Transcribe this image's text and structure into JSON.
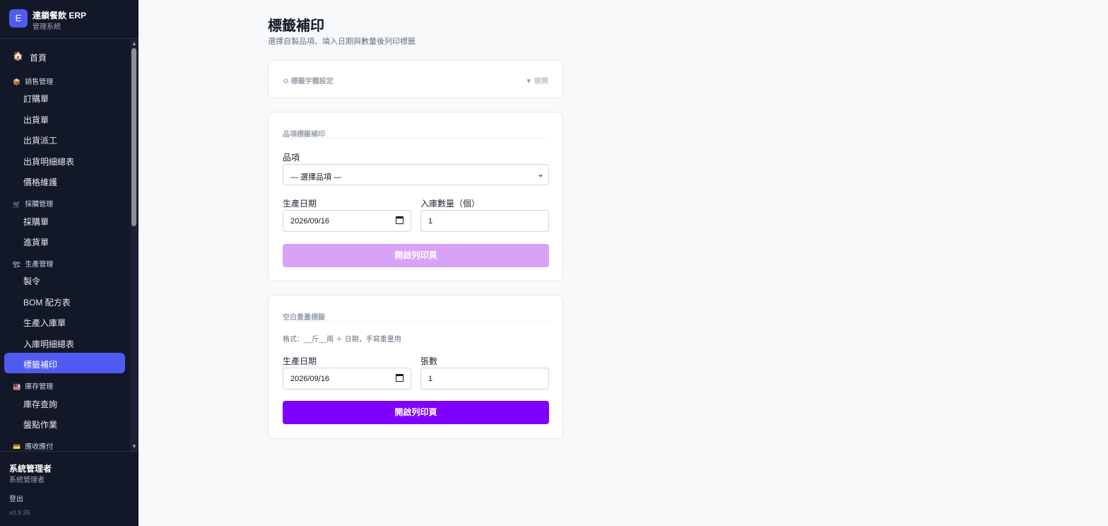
{
  "brand": {
    "logo": "E",
    "name": "連鎖餐飲 ERP",
    "sub": "管理系統"
  },
  "nav": {
    "home": {
      "icon": "🏠",
      "label": "首頁"
    },
    "groups": {
      "sales": {
        "icon": "📦",
        "label": "銷售管理"
      },
      "purchase": {
        "icon": "🛒",
        "label": "採購管理"
      },
      "production": {
        "icon": "🏗",
        "label": "生產管理"
      },
      "inventory": {
        "icon": "🏭",
        "label": "庫存管理"
      },
      "finance": {
        "icon": "💳",
        "label": "應收應付"
      }
    },
    "items": {
      "orders": "訂購單",
      "shipping": "出貨單",
      "dispatch": "出貨派工",
      "ship_detail": "出貨明細總表",
      "price": "價格維護",
      "purchase_order": "採購單",
      "receiving": "進貨單",
      "work_order": "製令",
      "bom": "BOM 配方表",
      "prod_in": "生產入庫單",
      "in_detail": "入庫明細總表",
      "label_reprint": "標籤補印",
      "stock_query": "庫存查詢",
      "stocktake": "盤點作業"
    }
  },
  "user": {
    "name": "系統管理者",
    "role": "系統管理者",
    "logout": "登出",
    "version": "v0.9.35"
  },
  "page": {
    "title": "標籤補印",
    "desc": "選擇自製品項、填入日期與數量後列印標籤"
  },
  "font_settings": {
    "title": "⚙ 標籤字體設定",
    "toggle": "▼ 展開"
  },
  "item_section": {
    "title": "品項標籤補印",
    "item_label": "品項",
    "item_value": "— 選擇品項 —",
    "date_label": "生產日期",
    "date_value": "2026/09/16",
    "qty_label": "入庫數量（個）",
    "qty_value": "1",
    "button": "開啟列印頁"
  },
  "blank_section": {
    "title": "空白重量標籤",
    "hint": "格式：__斤__兩 ＋ 日期，手寫重量用",
    "date_label": "生產日期",
    "date_value": "2026/09/16",
    "sheets_label": "張數",
    "sheets_value": "1",
    "button": "開啟列印頁"
  }
}
